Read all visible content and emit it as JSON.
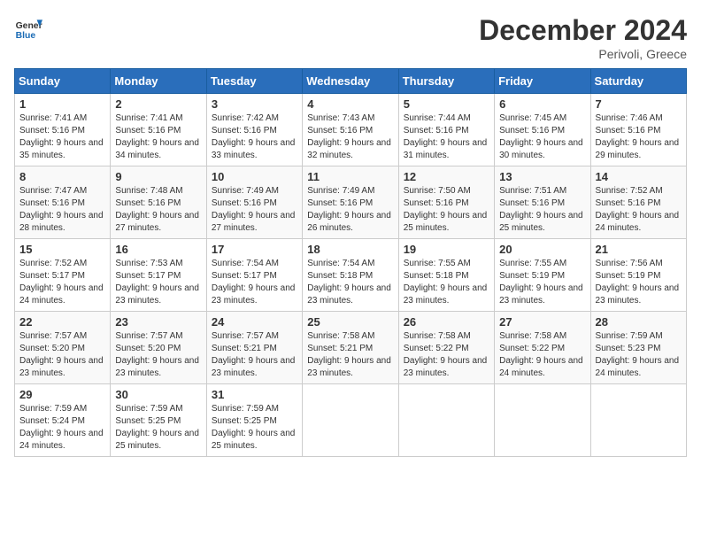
{
  "header": {
    "logo_line1": "General",
    "logo_line2": "Blue",
    "month": "December 2024",
    "location": "Perivoli, Greece"
  },
  "weekdays": [
    "Sunday",
    "Monday",
    "Tuesday",
    "Wednesday",
    "Thursday",
    "Friday",
    "Saturday"
  ],
  "weeks": [
    [
      {
        "day": "1",
        "sunrise": "7:41 AM",
        "sunset": "5:16 PM",
        "daylight": "9 hours and 35 minutes."
      },
      {
        "day": "2",
        "sunrise": "7:41 AM",
        "sunset": "5:16 PM",
        "daylight": "9 hours and 34 minutes."
      },
      {
        "day": "3",
        "sunrise": "7:42 AM",
        "sunset": "5:16 PM",
        "daylight": "9 hours and 33 minutes."
      },
      {
        "day": "4",
        "sunrise": "7:43 AM",
        "sunset": "5:16 PM",
        "daylight": "9 hours and 32 minutes."
      },
      {
        "day": "5",
        "sunrise": "7:44 AM",
        "sunset": "5:16 PM",
        "daylight": "9 hours and 31 minutes."
      },
      {
        "day": "6",
        "sunrise": "7:45 AM",
        "sunset": "5:16 PM",
        "daylight": "9 hours and 30 minutes."
      },
      {
        "day": "7",
        "sunrise": "7:46 AM",
        "sunset": "5:16 PM",
        "daylight": "9 hours and 29 minutes."
      }
    ],
    [
      {
        "day": "8",
        "sunrise": "7:47 AM",
        "sunset": "5:16 PM",
        "daylight": "9 hours and 28 minutes."
      },
      {
        "day": "9",
        "sunrise": "7:48 AM",
        "sunset": "5:16 PM",
        "daylight": "9 hours and 27 minutes."
      },
      {
        "day": "10",
        "sunrise": "7:49 AM",
        "sunset": "5:16 PM",
        "daylight": "9 hours and 27 minutes."
      },
      {
        "day": "11",
        "sunrise": "7:49 AM",
        "sunset": "5:16 PM",
        "daylight": "9 hours and 26 minutes."
      },
      {
        "day": "12",
        "sunrise": "7:50 AM",
        "sunset": "5:16 PM",
        "daylight": "9 hours and 25 minutes."
      },
      {
        "day": "13",
        "sunrise": "7:51 AM",
        "sunset": "5:16 PM",
        "daylight": "9 hours and 25 minutes."
      },
      {
        "day": "14",
        "sunrise": "7:52 AM",
        "sunset": "5:16 PM",
        "daylight": "9 hours and 24 minutes."
      }
    ],
    [
      {
        "day": "15",
        "sunrise": "7:52 AM",
        "sunset": "5:17 PM",
        "daylight": "9 hours and 24 minutes."
      },
      {
        "day": "16",
        "sunrise": "7:53 AM",
        "sunset": "5:17 PM",
        "daylight": "9 hours and 23 minutes."
      },
      {
        "day": "17",
        "sunrise": "7:54 AM",
        "sunset": "5:17 PM",
        "daylight": "9 hours and 23 minutes."
      },
      {
        "day": "18",
        "sunrise": "7:54 AM",
        "sunset": "5:18 PM",
        "daylight": "9 hours and 23 minutes."
      },
      {
        "day": "19",
        "sunrise": "7:55 AM",
        "sunset": "5:18 PM",
        "daylight": "9 hours and 23 minutes."
      },
      {
        "day": "20",
        "sunrise": "7:55 AM",
        "sunset": "5:19 PM",
        "daylight": "9 hours and 23 minutes."
      },
      {
        "day": "21",
        "sunrise": "7:56 AM",
        "sunset": "5:19 PM",
        "daylight": "9 hours and 23 minutes."
      }
    ],
    [
      {
        "day": "22",
        "sunrise": "7:57 AM",
        "sunset": "5:20 PM",
        "daylight": "9 hours and 23 minutes."
      },
      {
        "day": "23",
        "sunrise": "7:57 AM",
        "sunset": "5:20 PM",
        "daylight": "9 hours and 23 minutes."
      },
      {
        "day": "24",
        "sunrise": "7:57 AM",
        "sunset": "5:21 PM",
        "daylight": "9 hours and 23 minutes."
      },
      {
        "day": "25",
        "sunrise": "7:58 AM",
        "sunset": "5:21 PM",
        "daylight": "9 hours and 23 minutes."
      },
      {
        "day": "26",
        "sunrise": "7:58 AM",
        "sunset": "5:22 PM",
        "daylight": "9 hours and 23 minutes."
      },
      {
        "day": "27",
        "sunrise": "7:58 AM",
        "sunset": "5:22 PM",
        "daylight": "9 hours and 24 minutes."
      },
      {
        "day": "28",
        "sunrise": "7:59 AM",
        "sunset": "5:23 PM",
        "daylight": "9 hours and 24 minutes."
      }
    ],
    [
      {
        "day": "29",
        "sunrise": "7:59 AM",
        "sunset": "5:24 PM",
        "daylight": "9 hours and 24 minutes."
      },
      {
        "day": "30",
        "sunrise": "7:59 AM",
        "sunset": "5:25 PM",
        "daylight": "9 hours and 25 minutes."
      },
      {
        "day": "31",
        "sunrise": "7:59 AM",
        "sunset": "5:25 PM",
        "daylight": "9 hours and 25 minutes."
      },
      null,
      null,
      null,
      null
    ]
  ]
}
